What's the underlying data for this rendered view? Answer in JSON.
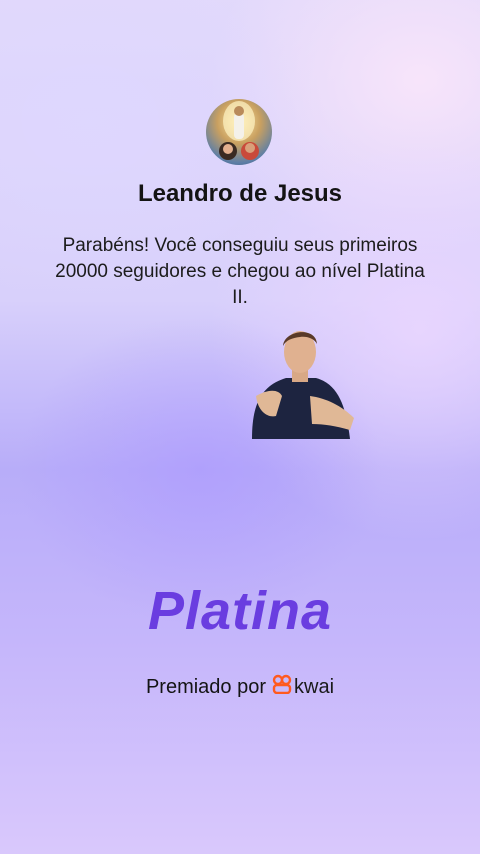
{
  "profile": {
    "name": "Leandro de Jesus"
  },
  "message": "Parabéns! Você conseguiu seus primeiros 20000 seguidores e chegou ao nível Platina II.",
  "badge": {
    "level_title": "Platina"
  },
  "footer": {
    "prefix": "Premiado por",
    "brand": "kwai",
    "brand_color": "#ff5a1f"
  },
  "colors": {
    "level_title": "#6a3de0"
  }
}
